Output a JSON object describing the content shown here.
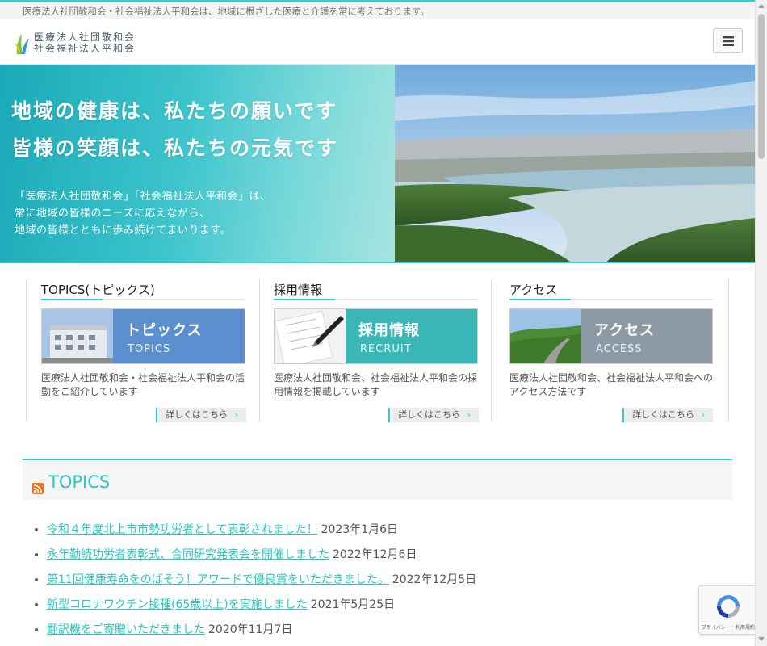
{
  "tagline": "医療法人社団敬和会・社会福祉法人平和会は、地域に根ざした医療と介護を常に考えております。",
  "logo": {
    "line1": "医療法人社団敬和会",
    "line2": "社会福祉法人平和会"
  },
  "menu_icon": "hamburger-icon",
  "hero": {
    "line1": "地域の健康は、私たちの願いです",
    "line2": "皆様の笑顔は、私たちの元気です",
    "sub1": "「医療法人社団敬和会」「社会福祉法人平和会」は、",
    "sub2": "常に地域の皆様のニーズに応えながら、",
    "sub3": "地域の皆様とともに歩み続けてまいります。"
  },
  "features": [
    {
      "title": "TOPICS(トピックス)",
      "banner_label": "トピックス",
      "banner_en": "TOPICS",
      "banner_color": "#5b8fd0",
      "description": "医療法人社団敬和会・社会福祉法人平和会の活動をご紹介しています",
      "more": "詳しくはこちら"
    },
    {
      "title": "採用情報",
      "banner_label": "採用情報",
      "banner_en": "RECRUIT",
      "banner_color": "#3bb6b6",
      "description": "医療法人社団敬和会、社会福祉法人平和会の採用情報を掲載しています",
      "more": "詳しくはこちら"
    },
    {
      "title": "アクセス",
      "banner_label": "アクセス",
      "banner_en": "ACCESS",
      "banner_color": "#8e99a6",
      "description": "医療法人社団敬和会、社会福祉法人平和会へのアクセス方法です",
      "more": "詳しくはこちら"
    }
  ],
  "topics": {
    "title": "TOPICS",
    "items": [
      {
        "title": "令和４年度北上市市勢功労者として表彰されました！",
        "date": "2023年1月6日"
      },
      {
        "title": "永年勤続功労者表彰式、合同研究発表会を開催しました",
        "date": "2022年12月6日"
      },
      {
        "title": "第11回健康寿命をのばそう！アワードで優良賞をいただきました。",
        "date": "2022年12月5日"
      },
      {
        "title": "新型コロナワクチン接種(65歳以上)を実施しました",
        "date": "2021年5月25日"
      },
      {
        "title": "翻訳機をご寄贈いただきました",
        "date": "2020年11月7日"
      }
    ]
  },
  "recaptcha": {
    "text": "プライバシー・利用規約"
  },
  "colors": {
    "accent": "#2ad4c8",
    "link": "#2ac6c2"
  }
}
